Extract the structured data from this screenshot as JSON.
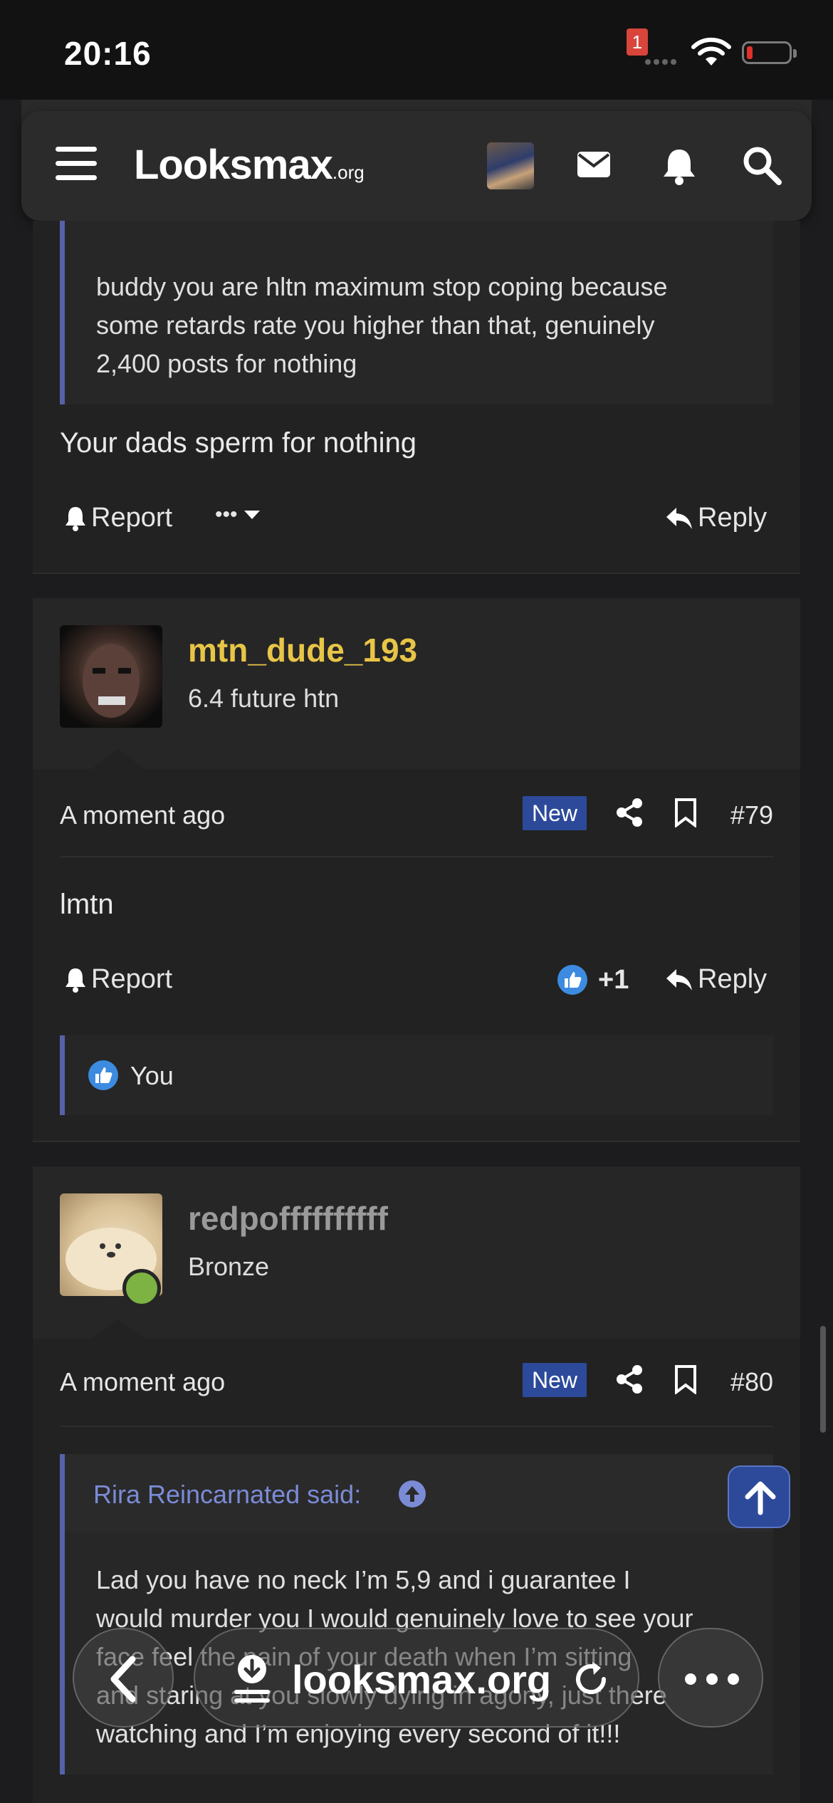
{
  "status_bar": {
    "time": "20:16"
  },
  "header": {
    "logo_main": "Looksmax",
    "logo_suffix": ".org",
    "notification_count": "1"
  },
  "post1": {
    "quote_lines": [
      "buddy you are hltn maximum stop coping because",
      "some retards rate you higher than that, genuinely",
      "2,400 posts for nothing"
    ],
    "text": "Your dads sperm for nothing",
    "report_label": "Report",
    "more_label": "•••",
    "reply_label": "Reply"
  },
  "post79": {
    "username": "mtn_dude_193",
    "username_color": "#e8c547",
    "user_title": "6.4 future htn",
    "time": "A moment ago",
    "badge": "New",
    "number": "#79",
    "text": "lmtn",
    "report_label": "Report",
    "like_count": "+1",
    "reply_label": "Reply",
    "likers": "You"
  },
  "post80": {
    "username": "redpoffffffffff",
    "username_color": "#9a9a9a",
    "user_title": "Bronze",
    "time": "A moment ago",
    "badge": "New",
    "number": "#80",
    "quote_author": "Rira Reincarnated said:",
    "quote_lines": [
      "Lad you have no neck I’m 5,9 and i guarantee I",
      "would murder you I would genuinely love to see your",
      "face feel the pain of your death when I’m sitting",
      "and staring at you slowly dying in agony, just there",
      "watching and I’m enjoying every second of it!!!"
    ]
  },
  "browser": {
    "url": "looksmax.org"
  },
  "colors": {
    "accent": "#2d4a9a",
    "quote_border": "#5562a8",
    "online": "#7cb342"
  }
}
